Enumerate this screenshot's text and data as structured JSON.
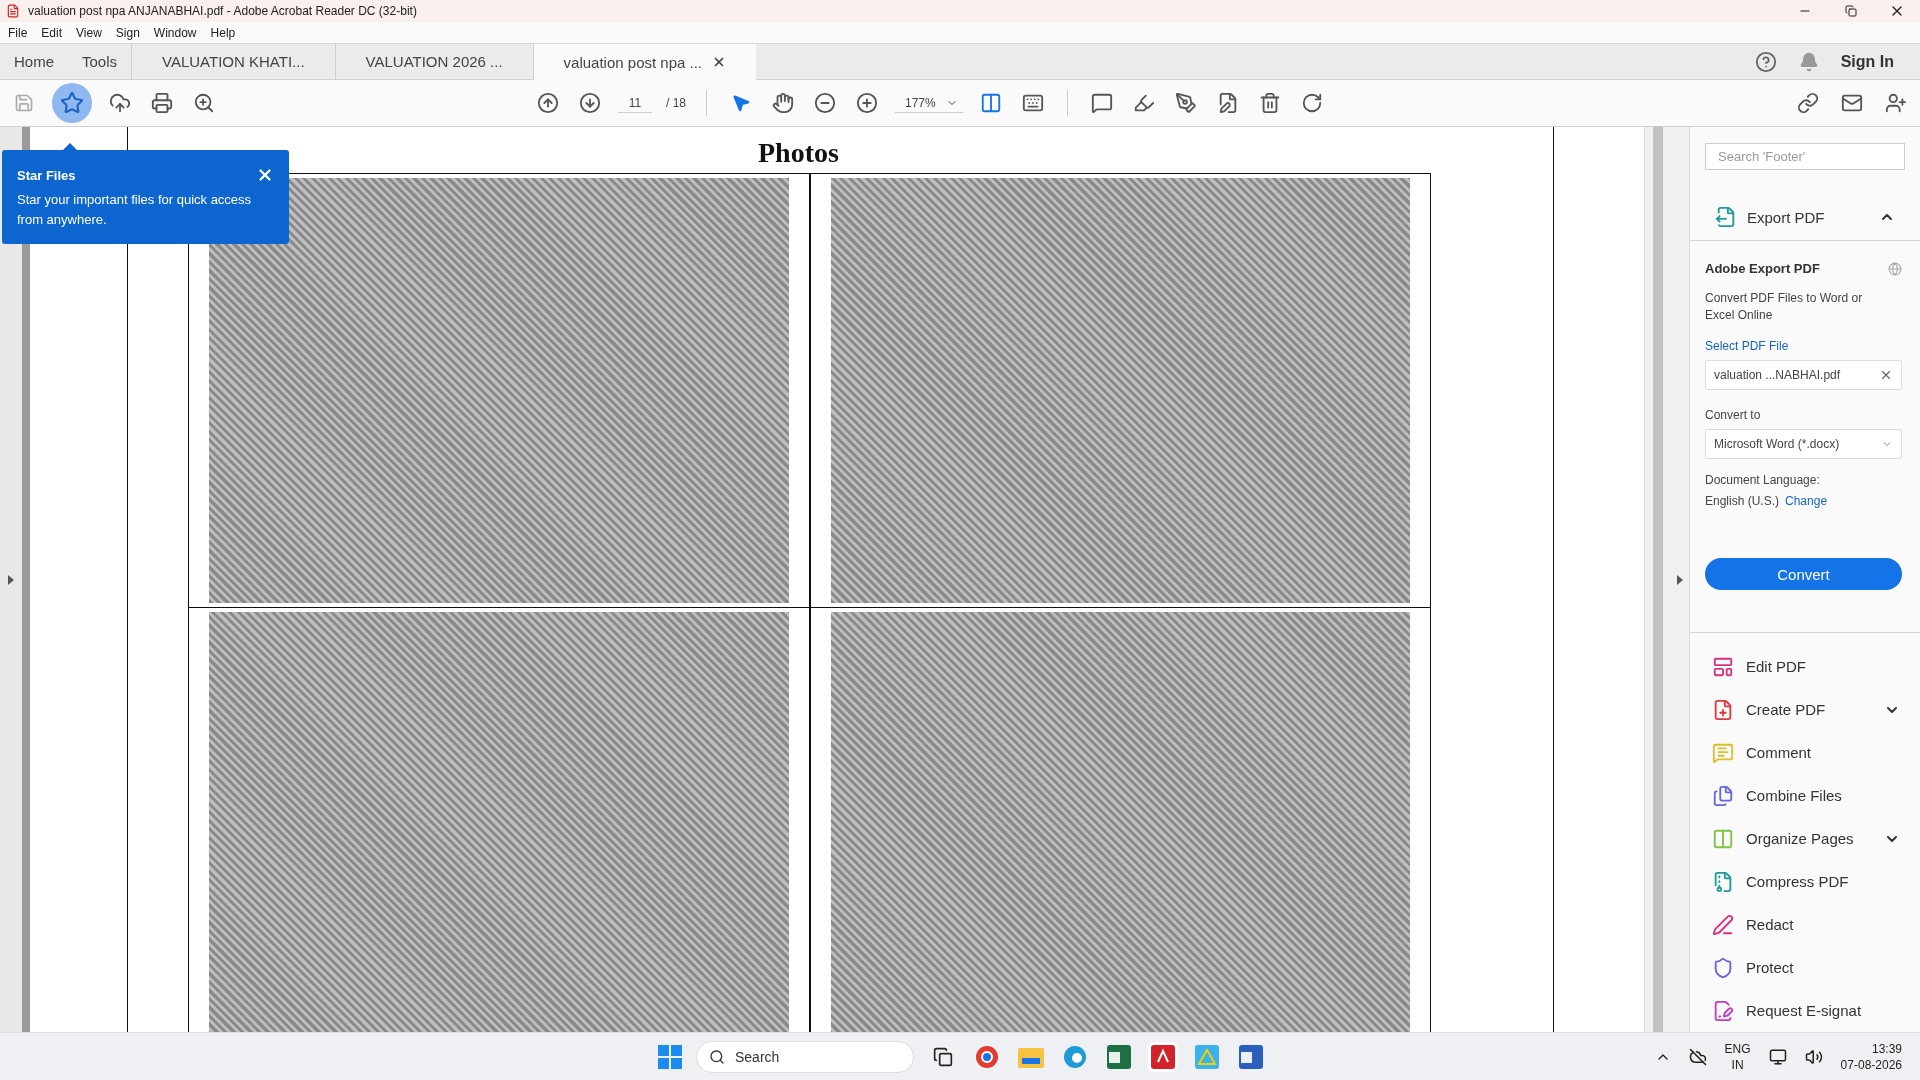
{
  "window": {
    "title": "valuation post npa ANJANABHAI.pdf - Adobe Acrobat Reader DC (32-bit)"
  },
  "menu": [
    "File",
    "Edit",
    "View",
    "Sign",
    "Window",
    "Help"
  ],
  "tabs": [
    {
      "label": "Home",
      "kind": "nav",
      "selected": false
    },
    {
      "label": "Tools",
      "kind": "nav",
      "selected": false
    },
    {
      "label": "VALUATION KHATI...",
      "kind": "document",
      "selected": false
    },
    {
      "label": "VALUATION 2026 ...",
      "kind": "document",
      "selected": false
    },
    {
      "label": "valuation post npa ...",
      "kind": "document",
      "selected": true
    }
  ],
  "account": {
    "sign_in": "Sign In"
  },
  "toolbar": {
    "star_active": true,
    "page": "11",
    "page_count": "/ 18",
    "zoom": "177%"
  },
  "tooltip": {
    "title": "Star Files",
    "text": "Star your important files for quick access from anywhere."
  },
  "document": {
    "heading": "Photos"
  },
  "right_panel": {
    "search": {
      "placeholder": "Search 'Footer'"
    },
    "export": {
      "title": "Export PDF",
      "expanded": true,
      "heading": "Adobe Export PDF",
      "description": "Convert PDF Files to Word or Excel Online",
      "select_label": "Select PDF File",
      "file": "valuation ...NABHAI.pdf",
      "convert_label": "Convert to",
      "format": "Microsoft Word (*.docx)",
      "language_label": "Document Language:",
      "language": "English (U.S.)",
      "change": "Change",
      "button": "Convert"
    },
    "tools": [
      {
        "label": "Edit PDF",
        "color": "#d6307c",
        "has_menu": false
      },
      {
        "label": "Create PDF",
        "color": "#e0393e",
        "has_menu": true
      },
      {
        "label": "Comment",
        "color": "#e0be2a",
        "has_menu": false
      },
      {
        "label": "Combine Files",
        "color": "#6464e6",
        "has_menu": false
      },
      {
        "label": "Organize Pages",
        "color": "#7cc540",
        "has_menu": true
      },
      {
        "label": "Compress PDF",
        "color": "#1f9a9a",
        "has_menu": false
      },
      {
        "label": "Redact",
        "color": "#d6307c",
        "has_menu": false
      },
      {
        "label": "Protect",
        "color": "#6464e6",
        "has_menu": false
      },
      {
        "label": "Request E-signat",
        "color": "#c539c5",
        "has_menu": false
      }
    ]
  },
  "taskbar": {
    "search": {
      "placeholder": "Search"
    },
    "language": "ENG",
    "region": "IN",
    "time": "13:39",
    "date": "07-08-2026"
  }
}
